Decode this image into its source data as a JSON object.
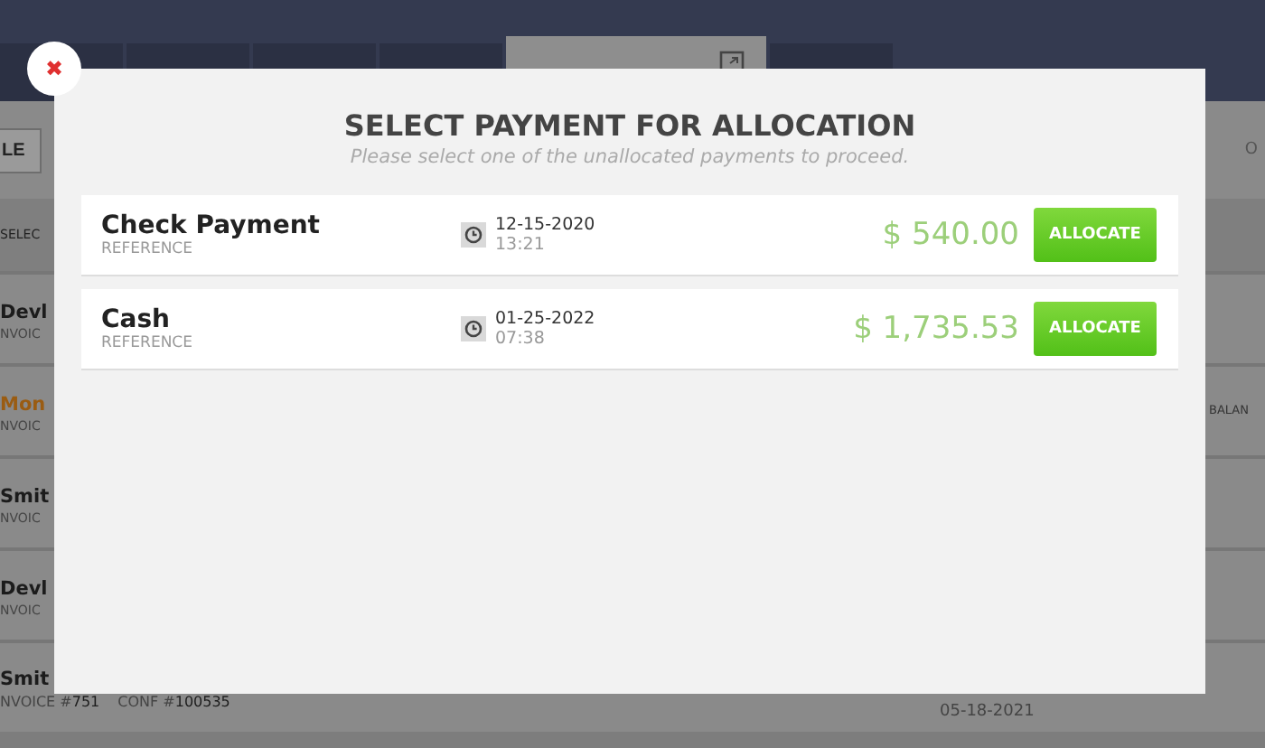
{
  "background": {
    "tabs": [
      {
        "selected": false
      },
      {
        "selected": false
      },
      {
        "selected": false
      },
      {
        "selected": false
      },
      {
        "selected": true
      },
      {
        "selected": false
      }
    ],
    "toolbar_button": "LE",
    "toolbar_right": "O",
    "select_label": "SELEC",
    "rows": [
      {
        "name": "Devl",
        "line": "NVOIC",
        "color": "#1c1c1c"
      },
      {
        "name": "Mon",
        "line": "NVOIC",
        "color": "#9a5c12",
        "note": "BALAN"
      },
      {
        "name": "Smit",
        "line": "NVOIC",
        "color": "#1c1c1c"
      },
      {
        "name": "Devl",
        "line": "NVOIC",
        "color": "#1c1c1c"
      },
      {
        "name": "Smit",
        "invoice_label": "NVOICE #",
        "invoice": "751",
        "conf_label": "CONF #",
        "conf": "100535",
        "date": "05-18-2021",
        "color": "#1c1c1c"
      }
    ]
  },
  "dialog": {
    "close": "✖",
    "title": "SELECT PAYMENT FOR ALLOCATION",
    "subtitle": "Please select one of the unallocated payments to proceed.",
    "payments": [
      {
        "name": "Check Payment",
        "reference": "REFERENCE",
        "date": "12-15-2020",
        "time": "13:21",
        "amount": "$ 540.00",
        "button": "ALLOCATE"
      },
      {
        "name": "Cash",
        "reference": "REFERENCE",
        "date": "01-25-2022",
        "time": "07:38",
        "amount": "$ 1,735.53",
        "button": "ALLOCATE"
      }
    ]
  }
}
